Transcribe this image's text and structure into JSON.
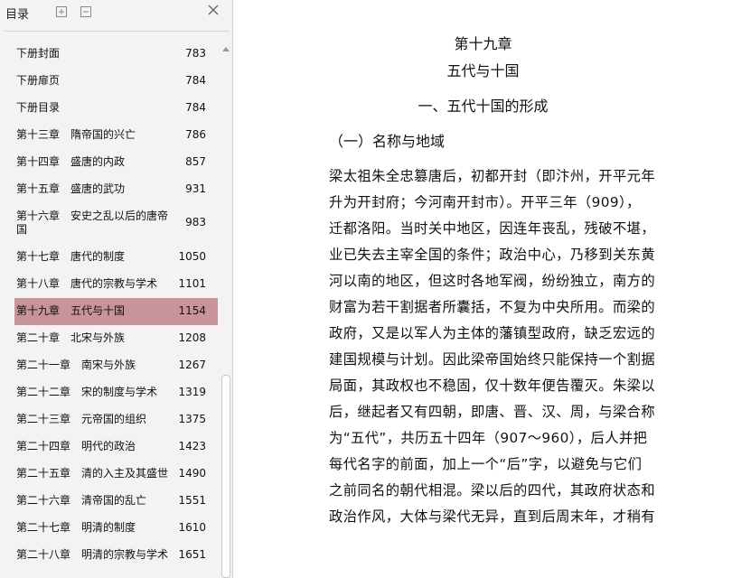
{
  "sidebar": {
    "title": "目录",
    "toc": [
      {
        "label": "下册封面",
        "page": "783"
      },
      {
        "label": "下册扉页",
        "page": "784"
      },
      {
        "label": "下册目录",
        "page": "784"
      },
      {
        "label": "第十三章　隋帝国的兴亡",
        "page": "786"
      },
      {
        "label": "第十四章　盛唐的内政",
        "page": "857"
      },
      {
        "label": "第十五章　盛唐的武功",
        "page": "931"
      },
      {
        "label": "第十六章　安史之乱以后的唐帝国",
        "page": "983"
      },
      {
        "label": "第十七章　唐代的制度",
        "page": "1050"
      },
      {
        "label": "第十八章　唐代的宗教与学术",
        "page": "1101"
      },
      {
        "label": "第十九章　五代与十国",
        "page": "1154",
        "selected": true
      },
      {
        "label": "第二十章　北宋与外族",
        "page": "1208"
      },
      {
        "label": "第二十一章　南宋与外族",
        "page": "1267"
      },
      {
        "label": "第二十二章　宋的制度与学术",
        "page": "1319"
      },
      {
        "label": "第二十三章　元帝国的组织",
        "page": "1375"
      },
      {
        "label": "第二十四章　明代的政治",
        "page": "1423"
      },
      {
        "label": "第二十五章　清的入主及其盛世",
        "page": "1490"
      },
      {
        "label": "第二十六章　清帝国的乱亡",
        "page": "1551"
      },
      {
        "label": "第二十七章　明清的制度",
        "page": "1610"
      },
      {
        "label": "第二十八章　明清的宗教与学术",
        "page": "1651"
      }
    ]
  },
  "document": {
    "chapter_number": "第十九章",
    "chapter_title": "五代与十国",
    "section_title": "一、五代十国的形成",
    "subsection_title": "（一）名称与地域",
    "lines": [
      "梁太祖朱全忠篡唐后，初都开封（即汴州，开平元年",
      "升为开封府；今河南开封市）。开平三年（909），",
      "迁都洛阳。当时关中地区，因连年丧乱，残破不堪，",
      "业已失去主宰全国的条件；政治中心，乃移到关东黄",
      "河以南的地区，但这时各地军阀，纷纷独立，南方的",
      "财富为若干割据者所囊括，不复为中央所用。而梁的",
      "政府，又是以军人为主体的藩镇型政府，缺乏宏远的",
      "建国规模与计划。因此梁帝国始终只能保持一个割据",
      "局面，其政权也不稳固，仅十数年便告覆灭。朱梁以",
      "后，继起者又有四朝，即唐、晋、汉、周，与梁合称",
      "为“五代”，共历五十四年（907～960），后人并把",
      "每代名字的前面，加上一个“后”字，以避免与它们",
      "之前同名的朝代相混。梁以后的四代，其政府状态和",
      "政治作风，大体与梁代无异，直到后周末年，才稍有"
    ]
  },
  "colors": {
    "selected_row": "#c99499",
    "sidebar_bg": "#f3f3f3"
  }
}
